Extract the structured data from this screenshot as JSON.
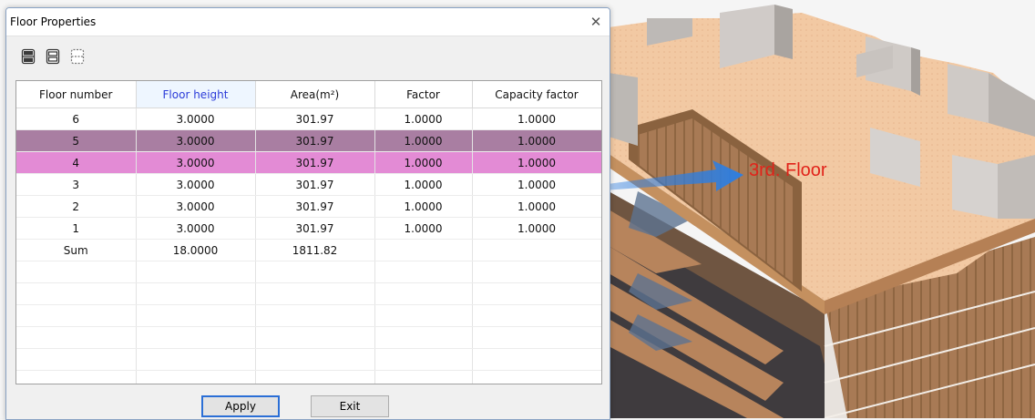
{
  "dialog": {
    "title": "Floor Properties",
    "close_icon": "close-icon"
  },
  "toolbar": {
    "icons": [
      "insert-floor-icon",
      "add-floor-icon",
      "delete-floor-icon"
    ]
  },
  "table": {
    "columns": [
      "Floor number",
      "Floor height",
      "Area(m²)",
      "Factor",
      "Capacity factor"
    ],
    "active_column": 1,
    "rows": [
      [
        "6",
        "3.0000",
        "301.97",
        "1.0000",
        "1.0000"
      ],
      [
        "5",
        "3.0000",
        "301.97",
        "1.0000",
        "1.0000"
      ],
      [
        "4",
        "3.0000",
        "301.97",
        "1.0000",
        "1.0000"
      ],
      [
        "3",
        "3.0000",
        "301.97",
        "1.0000",
        "1.0000"
      ],
      [
        "2",
        "3.0000",
        "301.97",
        "1.0000",
        "1.0000"
      ],
      [
        "1",
        "3.0000",
        "301.97",
        "1.0000",
        "1.0000"
      ]
    ],
    "sum_row": [
      "Sum",
      "18.0000",
      "1811.82",
      "",
      ""
    ],
    "selected_rows": [
      "5",
      "4"
    ]
  },
  "buttons": {
    "apply_label": "Apply",
    "exit_label": "Exit"
  },
  "viewport": {
    "callout_text": "3rd. Floor"
  },
  "colors": {
    "selected_row_dark": "#a97ea2",
    "selected_row_light": "#e38bd5",
    "active_header_text": "#2b3bd8",
    "callout_text": "#e1231a",
    "arrow": "#2e7ee0"
  }
}
